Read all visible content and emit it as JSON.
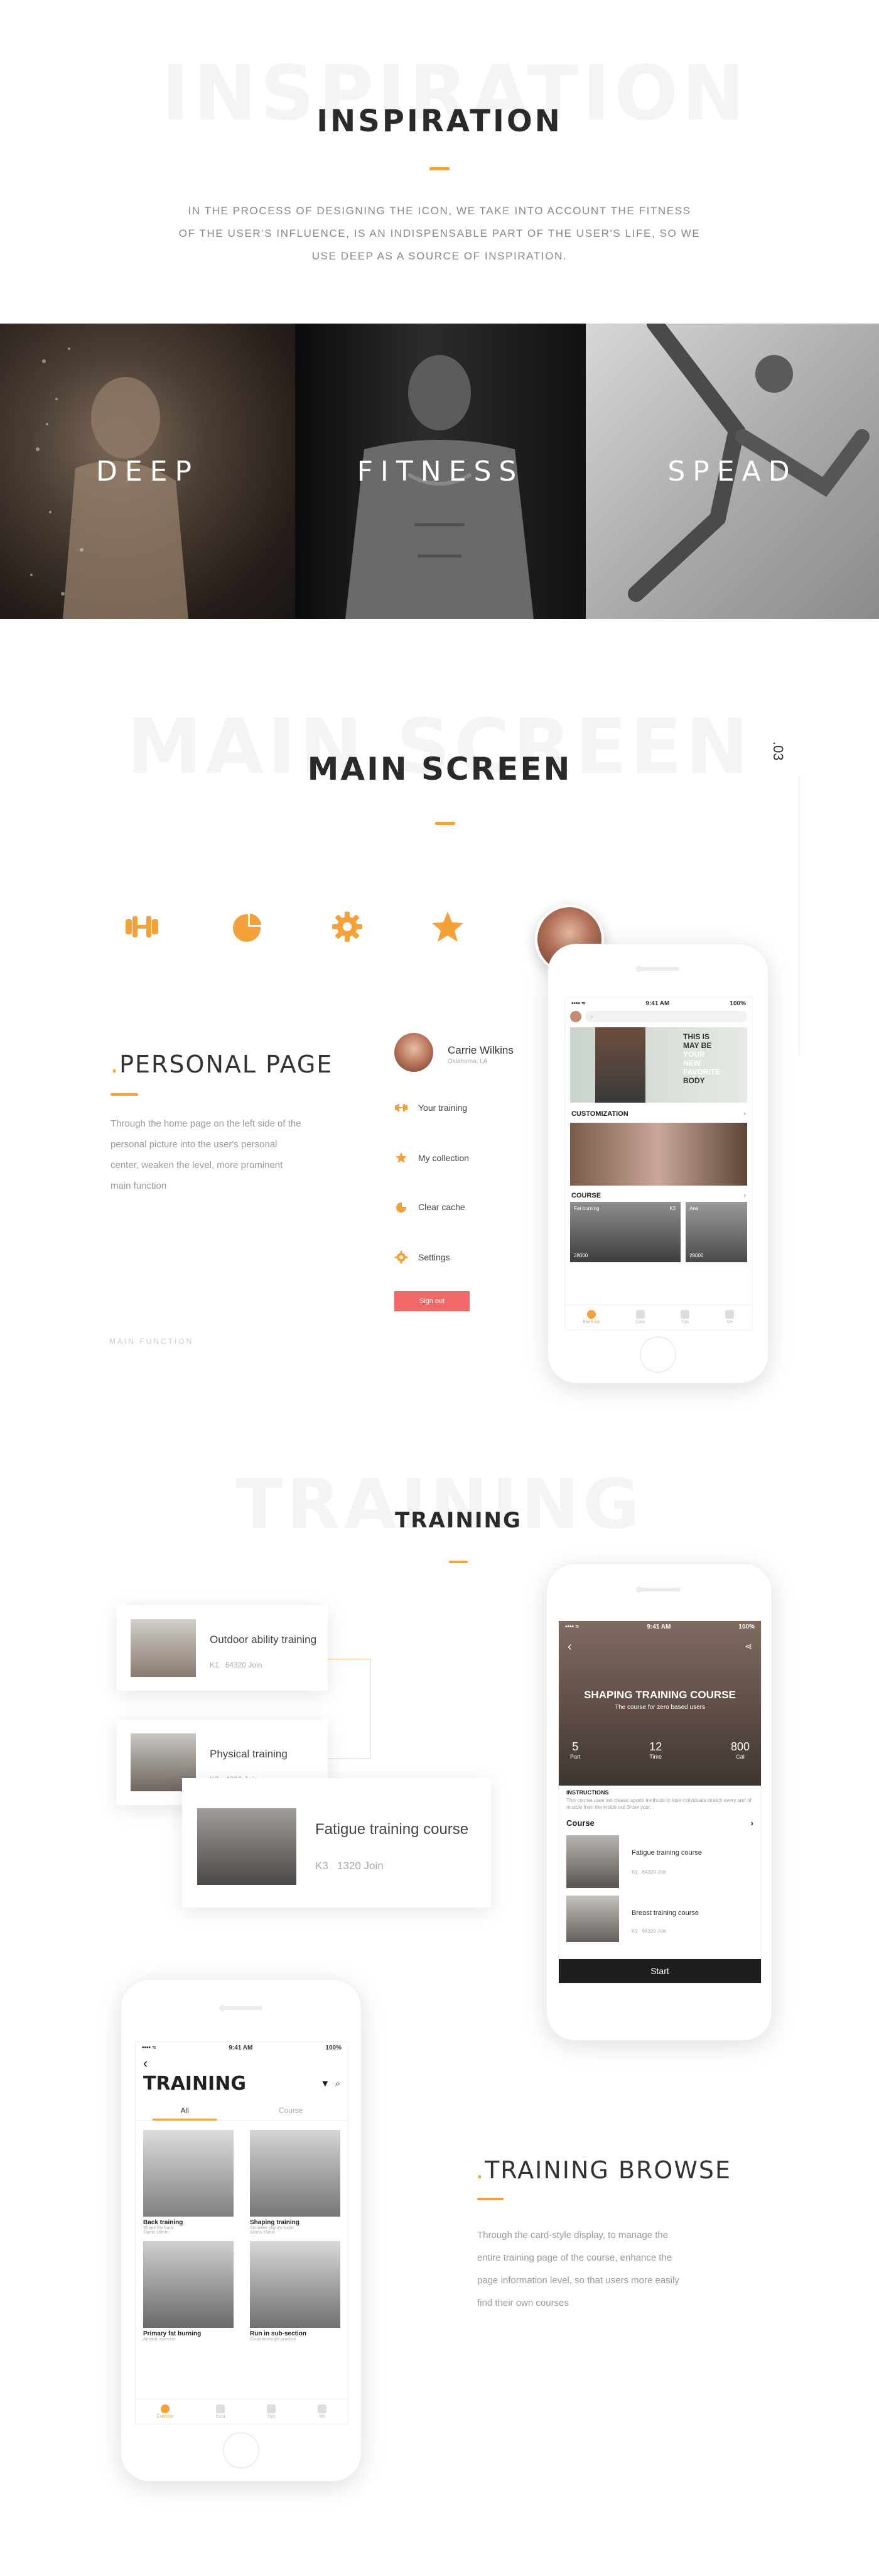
{
  "inspiration": {
    "ghost": "INSPIRATION",
    "title": "INSPIRATION",
    "text_line1": "IN THE PROCESS OF DESIGNING THE ICON, WE TAKE INTO ACCOUNT THE FITNESS",
    "text_line2": "OF THE USER'S INFLUENCE, IS AN INDISPENSABLE PART OF THE USER'S LIFE, SO WE",
    "text_line3": "USE DEEP AS A SOURCE OF INSPIRATION.",
    "photos": [
      "DEEP",
      "FITNESS",
      "SPEAD"
    ]
  },
  "main_screen": {
    "ghost": "MAIN SCREEN",
    "title": "MAIN SCREEN",
    "side_index": ".03",
    "personal_title": "PERSONAL PAGE",
    "personal_text": [
      "Through the home page on the left side of the",
      "personal picture into the user's personal",
      "center, weaken the level, more prominent",
      "main function"
    ],
    "main_function": "MAIN FUNCTION",
    "profile": {
      "name": "Carrie Wilkins",
      "location": "Oklahoma, LA"
    },
    "menu": [
      "Your training",
      "My collection",
      "Clear cache",
      "Settings"
    ],
    "sign_out": "Sign out",
    "app": {
      "time": "9:41 AM",
      "battery": "100%",
      "banner_lines": [
        "THIS IS",
        "MAY BE",
        "YOUR",
        "NEW",
        "FAVORITE",
        "BODY"
      ],
      "customization": "CUSTOMIZATION",
      "course": "COURSE",
      "course_items": [
        {
          "name": "Fat burning",
          "level": "K3",
          "join": "28000"
        },
        {
          "name": "Ana",
          "level": "",
          "join": "28000"
        }
      ],
      "tabs": [
        "Exercise",
        "Data",
        "Tips",
        "Me"
      ]
    }
  },
  "training": {
    "ghost": "TRAINING",
    "title": "TRAINING",
    "cards": [
      {
        "title": "Outdoor ability training",
        "level": "K1",
        "join": "64320 Join"
      },
      {
        "title": "Physical training",
        "level": "K2",
        "join": "4320 Join"
      },
      {
        "title": "Fatigue training course",
        "level": "K3",
        "join": "1320 Join"
      }
    ],
    "detail": {
      "time": "9:41 AM",
      "battery": "100%",
      "heading": "SHAPING TRAINING COURSE",
      "subheading": "The course for zero based users",
      "stats": [
        {
          "value": "5",
          "label": "Part"
        },
        {
          "value": "12",
          "label": "Time"
        },
        {
          "value": "800",
          "label": "Cal"
        }
      ],
      "instructions_label": "INSTRUCTIONS",
      "instructions_text": "This course uses ten classic sports methods to lose individuals stretch every sort of muscle from the inside out Show your...",
      "course_label": "Course",
      "items": [
        {
          "title": "Fatigue training course",
          "level": "K1",
          "join": "64320 Join"
        },
        {
          "title": "Breast training course",
          "level": "K1",
          "join": "64320 Join"
        }
      ],
      "start": "Start"
    }
  },
  "browse": {
    "title": "TRAINING BROWSE",
    "text": [
      "Through the card-style display, to manage the",
      "entire training page of the course, enhance the",
      "page information level, so that users more easily",
      "find their own courses"
    ],
    "app": {
      "time": "9:41 AM",
      "battery": "100%",
      "heading": "TRAINING",
      "tabs": [
        "All",
        "Course"
      ],
      "tiles": [
        {
          "title": "Back training",
          "sub": "Shape the back",
          "meta": "18min  16min"
        },
        {
          "title": "Shaping training",
          "sub": "Shoulder slightly wider",
          "meta": "18min  16min"
        },
        {
          "title": "Primary fat burning",
          "sub": "Aerobic exercise",
          "meta": "18min  16min"
        },
        {
          "title": "Run in sub-section",
          "sub": "Countertweight practice",
          "meta": "18min  16min"
        }
      ],
      "bottom_tabs": [
        "Exercise",
        "Data",
        "Tips",
        "Me"
      ]
    }
  },
  "colors": {
    "accent": "#f5a13a",
    "signout": "#f06868",
    "dark": "#2a2a2a"
  }
}
